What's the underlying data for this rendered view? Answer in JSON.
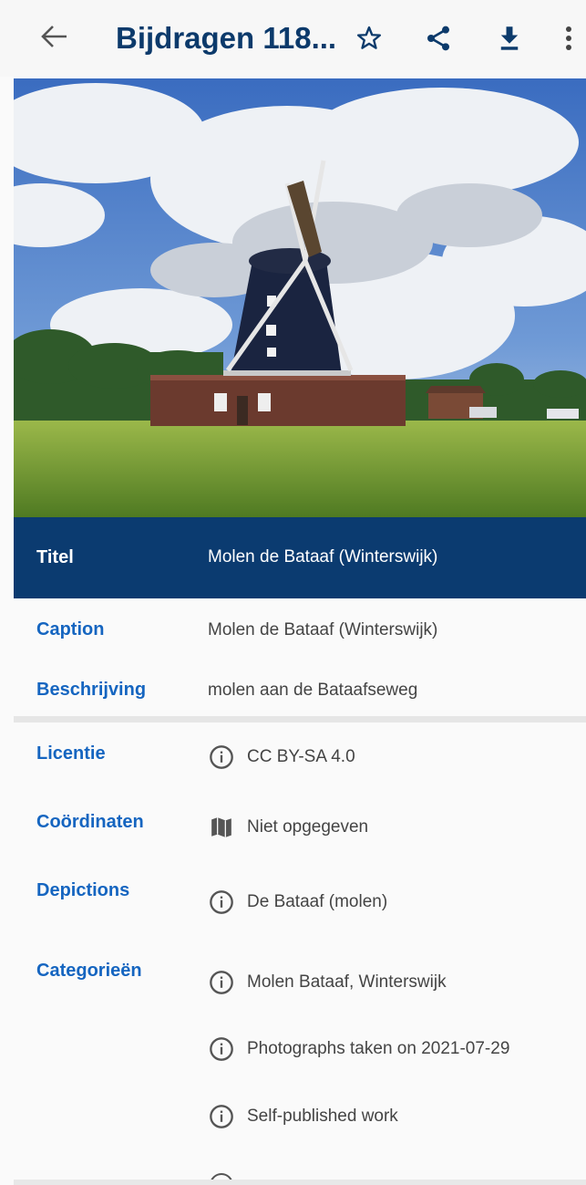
{
  "toolbar": {
    "title": "Bijdragen 118...",
    "icons": [
      "back-arrow-icon",
      "star-icon",
      "share-icon",
      "download-icon",
      "more-vert-icon"
    ]
  },
  "photo": {
    "alt": "windmill"
  },
  "details": {
    "title_label": "Titel",
    "title_value": "Molen de Bataaf (Winterswijk)",
    "caption_label": "Caption",
    "caption_value": "Molen de Bataaf (Winterswijk)",
    "description_label": "Beschrijving",
    "description_value": "molen aan de Bataafseweg",
    "license_label": "Licentie",
    "license_value": "CC BY-SA 4.0",
    "coordinates_label": "Coördinaten",
    "coordinates_value": "Niet opgegeven",
    "depictions_label": "Depictions",
    "depictions_value": "De Bataaf (molen)",
    "categories_label": "Categorieën",
    "categories": [
      "Molen Bataaf, Winterswijk",
      "Photographs taken on 2021-07-29",
      "Self-published work"
    ]
  },
  "colors": {
    "title_bar": "#0b3b70",
    "label": "#1565c0",
    "toolbar_title": "#0c3a6b"
  }
}
